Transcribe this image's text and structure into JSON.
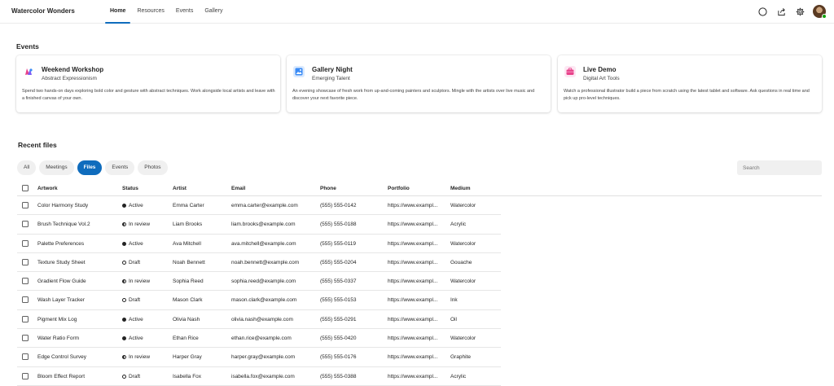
{
  "app": {
    "title": "Watercolor Wonders"
  },
  "nav": [
    {
      "label": "Home",
      "active": true
    },
    {
      "label": "Resources",
      "active": false
    },
    {
      "label": "Events",
      "active": false
    },
    {
      "label": "Gallery",
      "active": false
    }
  ],
  "events": {
    "title": "Events",
    "cards": [
      {
        "title": "Weekend Workshop",
        "subtitle": "Abstract Expressionism",
        "icon": "palette-icon",
        "description": "Spend two hands-on days exploring bold color and gesture with abstract techniques. Work alongside local artists and leave with a finished canvas of your own."
      },
      {
        "title": "Gallery Night",
        "subtitle": "Emerging Talent",
        "icon": "image-icon",
        "description": "An evening showcase of fresh work from up-and-coming painters and sculptors. Mingle with the artists over live music and discover your next favorite piece."
      },
      {
        "title": "Live Demo",
        "subtitle": "Digital Art Tools",
        "icon": "briefcase-icon",
        "description": "Watch a professional illustrator build a piece from scratch using the latest tablet and software. Ask questions in real time and pick up pro-level techniques."
      }
    ]
  },
  "files": {
    "title": "Recent files",
    "filters": [
      {
        "label": "All",
        "active": false
      },
      {
        "label": "Meetings",
        "active": false
      },
      {
        "label": "Files",
        "active": true
      },
      {
        "label": "Events",
        "active": false
      },
      {
        "label": "Photos",
        "active": false
      }
    ],
    "search_placeholder": "Search",
    "columns": [
      "Artwork",
      "Status",
      "Artist",
      "Email",
      "Phone",
      "Portfolio",
      "Medium"
    ],
    "rows": [
      {
        "artwork": "Color Harmony Study",
        "status": "Active",
        "artist": "Emma Carter",
        "email": "emma.carter@example.com",
        "phone": "(555) 555-0142",
        "portfolio": "https://www.exampl...",
        "medium": "Watercolor"
      },
      {
        "artwork": "Brush Technique Vol.2",
        "status": "In review",
        "artist": "Liam Brooks",
        "email": "liam.brooks@example.com",
        "phone": "(555) 555-0188",
        "portfolio": "https://www.exampl...",
        "medium": "Acrylic"
      },
      {
        "artwork": "Palette Preferences",
        "status": "Active",
        "artist": "Ava Mitchell",
        "email": "ava.mitchell@example.com",
        "phone": "(555) 555-0119",
        "portfolio": "https://www.exampl...",
        "medium": "Watercolor"
      },
      {
        "artwork": "Texture Study Sheet",
        "status": "Draft",
        "artist": "Noah Bennett",
        "email": "noah.bennett@example.com",
        "phone": "(555) 555-0204",
        "portfolio": "https://www.exampl...",
        "medium": "Gouache"
      },
      {
        "artwork": "Gradient Flow Guide",
        "status": "In review",
        "artist": "Sophia Reed",
        "email": "sophia.reed@example.com",
        "phone": "(555) 555-0337",
        "portfolio": "https://www.exampl...",
        "medium": "Watercolor"
      },
      {
        "artwork": "Wash Layer Tracker",
        "status": "Draft",
        "artist": "Mason Clark",
        "email": "mason.clark@example.com",
        "phone": "(555) 555-0153",
        "portfolio": "https://www.exampl...",
        "medium": "Ink"
      },
      {
        "artwork": "Pigment Mix Log",
        "status": "Active",
        "artist": "Olivia Nash",
        "email": "olivia.nash@example.com",
        "phone": "(555) 555-0291",
        "portfolio": "https://www.exampl...",
        "medium": "Oil"
      },
      {
        "artwork": "Water Ratio Form",
        "status": "Active",
        "artist": "Ethan Rice",
        "email": "ethan.rice@example.com",
        "phone": "(555) 555-0420",
        "portfolio": "https://www.exampl...",
        "medium": "Watercolor"
      },
      {
        "artwork": "Edge Control Survey",
        "status": "In review",
        "artist": "Harper Gray",
        "email": "harper.gray@example.com",
        "phone": "(555) 555-0176",
        "portfolio": "https://www.exampl...",
        "medium": "Graphite"
      },
      {
        "artwork": "Bloom Effect Report",
        "status": "Draft",
        "artist": "Isabella Fox",
        "email": "isabella.fox@example.com",
        "phone": "(555) 555-0388",
        "portfolio": "https://www.exampl...",
        "medium": "Acrylic"
      }
    ]
  },
  "colors": {
    "accent": "#0f6cbd",
    "presence": "#13a10e"
  }
}
